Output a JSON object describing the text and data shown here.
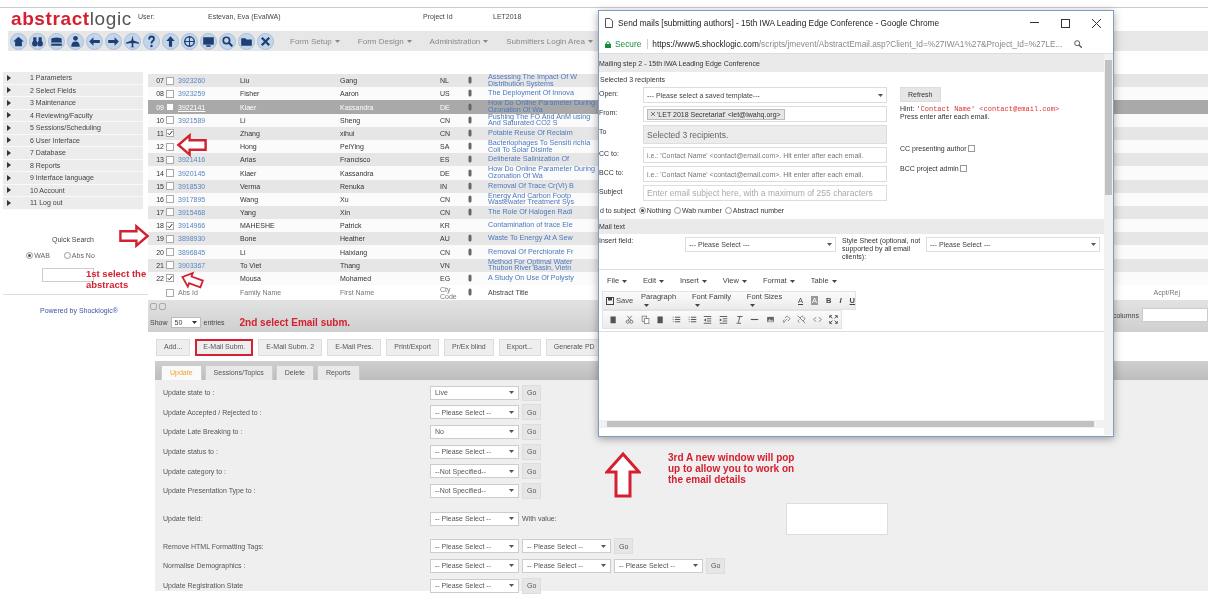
{
  "header": {
    "logo": {
      "part_1": "abstract",
      "part_2": "logic"
    },
    "user_label": "User:",
    "user_name": "Estevan, Eva (EvalWA)",
    "project_label": "Project Id",
    "project_id": "LET2018",
    "menus": [
      "Form Setup",
      "Form Design",
      "Administration",
      "Submitters Login Area"
    ]
  },
  "sidebar": {
    "items": [
      "1 Parameters",
      "2 Select Fields",
      "3 Maintenance",
      "4 Reviewing/Faculty",
      "5 Sessions/Scheduling",
      "6 User Interface",
      "7 Database",
      "8 Reports",
      "9 Interface language",
      "10 Account",
      "11 Log out"
    ],
    "quick_search": {
      "title": "Quick Search",
      "options": [
        {
          "label": "WAB",
          "selected": true
        },
        {
          "label": "Abs No",
          "selected": false
        }
      ]
    },
    "powered_by": "Powered by Shocklogic®"
  },
  "table": {
    "rows": [
      {
        "num": "07",
        "checked": false,
        "selected": false,
        "id": "3923260",
        "family": "Liu",
        "first": "Gang",
        "country": "NL",
        "attachment": true,
        "title": "Assessing The Impact Of W Distribution Systems"
      },
      {
        "num": "08",
        "checked": false,
        "selected": false,
        "id": "3923259",
        "family": "Fisher",
        "first": "Aaron",
        "country": "US",
        "attachment": true,
        "title": "The Deployment Of Innova"
      },
      {
        "num": "09",
        "checked": false,
        "selected": true,
        "id": "3922141",
        "family": "Klaer",
        "first": "Kassandra",
        "country": "DE",
        "attachment": true,
        "title": "How Do Online Parameter During Ozonation Of Wa"
      },
      {
        "num": "10",
        "checked": false,
        "selected": false,
        "id": "3921589",
        "family": "Li",
        "first": "Sheng",
        "country": "CN",
        "attachment": true,
        "title": "Pushing The FO And AnM using And Saturated CO2 S"
      },
      {
        "num": "11",
        "checked": true,
        "selected": false,
        "family": "Zhang",
        "first": "xihui",
        "country": "CN",
        "attachment": true,
        "title": "Potable Reuse Of Reclaim"
      },
      {
        "num": "12",
        "checked": false,
        "selected": false,
        "family": "Hong",
        "first": "PeiYing",
        "country": "SA",
        "attachment": true,
        "title": "Bacteriophages To Sensiti richia Coli To Solar Disinfe"
      },
      {
        "num": "13",
        "checked": false,
        "selected": false,
        "id": "3921416",
        "family": "Arias",
        "first": "Francisco",
        "country": "ES",
        "attachment": true,
        "title": "Deliberate Salinization Of"
      },
      {
        "num": "14",
        "checked": false,
        "selected": false,
        "id": "3920145",
        "family": "Klaer",
        "first": "Kassandra",
        "country": "DE",
        "attachment": true,
        "title": "How Do Online Parameter During Ozonation Of Wa"
      },
      {
        "num": "15",
        "checked": false,
        "selected": false,
        "id": "3918530",
        "family": "Verma",
        "first": "Renuka",
        "country": "IN",
        "attachment": true,
        "title": "Removal Of Trace Cr(VI) B"
      },
      {
        "num": "16",
        "checked": false,
        "selected": false,
        "id": "3917895",
        "family": "Wang",
        "first": "Xu",
        "country": "CN",
        "attachment": true,
        "title": "Energy And Carbon Footp Wastewater Treatment Sys"
      },
      {
        "num": "17",
        "checked": false,
        "selected": false,
        "id": "3915468",
        "family": "Yang",
        "first": "Xin",
        "country": "CN",
        "attachment": true,
        "title": "The Role Of Halogen Radi"
      },
      {
        "num": "18",
        "checked": true,
        "selected": false,
        "id": "3914966",
        "family": "MAHESHE",
        "first": "Patrick",
        "country": "KR",
        "attachment": false,
        "title": "Contamination of trace Ele"
      },
      {
        "num": "19",
        "checked": false,
        "selected": false,
        "id": "3898930",
        "family": "Bone",
        "first": "Heather",
        "country": "AU",
        "attachment": true,
        "title": "Waste To Energy At A Sew"
      },
      {
        "num": "20",
        "checked": false,
        "selected": false,
        "id": "3896845",
        "family": "Li",
        "first": "Haixiang",
        "country": "CN",
        "attachment": true,
        "title": "Removal Of Perchlorate Fr"
      },
      {
        "num": "21",
        "checked": false,
        "selected": false,
        "id": "3903367",
        "family": "To Viet",
        "first": "Thang",
        "country": "VN",
        "attachment": false,
        "title": "Method For Optimal Water Thubon River Basin, Vietn"
      },
      {
        "num": "22",
        "checked": true,
        "selected": false,
        "family": "Mousa",
        "first": "Mohamed",
        "country": "EG",
        "attachment": true,
        "title": "A Study On Use Of Polysty"
      }
    ],
    "footer": {
      "checked": false,
      "id": "Abs Id",
      "family": "Family Name",
      "first": "First Name",
      "country": "Cty Code",
      "title": "Abstract Title",
      "acpt": "Acpt/Rej"
    },
    "pager": {
      "show": "Show",
      "count": "50",
      "entries": "entries",
      "columns_label": "columns"
    }
  },
  "buttons": [
    {
      "label": "Add...",
      "outlined": false
    },
    {
      "label": "E-Mail Subm.",
      "outlined": true
    },
    {
      "label": "E-Mail Subm. 2",
      "outlined": false
    },
    {
      "label": "E-Mail Pres.",
      "outlined": false
    },
    {
      "label": "Print/Export",
      "outlined": false
    },
    {
      "label": "Pr/Ex blind",
      "outlined": false
    },
    {
      "label": "Export...",
      "outlined": false
    },
    {
      "label": "Generate PD",
      "outlined": false
    }
  ],
  "tabs": [
    {
      "label": "Update",
      "selected": true
    },
    {
      "label": "Sessions/Topics",
      "selected": false
    },
    {
      "label": "Delete",
      "selected": false
    },
    {
      "label": "Reports",
      "selected": false
    }
  ],
  "update_rows": [
    {
      "label": "Update state to :",
      "selects": [
        "Live"
      ],
      "go": "Go"
    },
    {
      "label": "Update Accepted / Rejected to :",
      "selects": [
        "-- Please Select --"
      ],
      "go": "Go"
    },
    {
      "label": "Update Late Breaking to :",
      "selects": [
        "No"
      ],
      "go": "Go"
    },
    {
      "label": "Update status to :",
      "selects": [
        "-- Please Select --"
      ],
      "go": "Go"
    },
    {
      "label": "Update category to :",
      "selects": [
        "--Not Specified--"
      ],
      "go": "Go"
    },
    {
      "label": "Update Presentation Type to :",
      "selects": [
        "--Not Specified--"
      ],
      "go": "Go"
    },
    {
      "label": "Update field:",
      "selects": [
        "-- Please Select --"
      ],
      "value_label": "With value:"
    },
    {
      "label": "Remove HTML Formatting Tags:",
      "selects": [
        "-- Please Select --",
        "-- Please Select --"
      ],
      "go": "Go"
    },
    {
      "label": "Normalise Demographics :",
      "selects": [
        "-- Please Select --",
        "-- Please Select --",
        "-- Please Select --"
      ],
      "go": "Go"
    },
    {
      "label": "Update Registration State",
      "selects": [
        "-- Please Select --"
      ],
      "go": "Go"
    }
  ],
  "popup": {
    "window_title": "Send mails [submitting authors] - 15th IWA Leading Edge Conference - Google Chrome",
    "secure": "Secure",
    "url_host": "https://www5.shocklogic.com",
    "url_path": "/scripts/jmevent/AbstractEmail.asp?Client_Id=%27IWA1%27&Project_Id=%27LE...",
    "step_title": "Mailing step 2 - 15th IWA Leading Edge Conference",
    "selected_note": "Selected 3 recipients",
    "fields": [
      {
        "label": "Open:",
        "kind": "select",
        "value": "--- Please select a saved template---"
      },
      {
        "label": "From:",
        "kind": "tags",
        "tags": [
          "'LET 2018 Secretariat' <let@iwahq.org>"
        ]
      },
      {
        "label": "To",
        "kind": "readonly",
        "value": "Selected 3 recipients."
      },
      {
        "label": "CC to:",
        "kind": "input",
        "placeholder": "i.e.: 'Contact Name' <contact@email.com>. Hit enter after each email."
      },
      {
        "label": "BCC to:",
        "kind": "input",
        "placeholder": "i.e.: 'Contact Name' <contact@email.com>. Hit enter after each email."
      },
      {
        "label": "Subject",
        "kind": "input",
        "placeholder": "Enter email subject here, with a maximum of 255 characters"
      }
    ],
    "refresh": "Refresh",
    "hint_label": "Hint:",
    "hint_code": "'Contact Name' <contact@email.com>",
    "hint_note": "Press enter after each email.",
    "options": [
      {
        "label": "CC presenting author",
        "checked": false
      },
      {
        "label": "BCC project admin",
        "checked": false
      }
    ],
    "add_to_subject": {
      "label": "d to subject",
      "options": [
        {
          "label": "Nothing",
          "selected": true
        },
        {
          "label": "Wab number",
          "selected": false
        },
        {
          "label": "Abstract number",
          "selected": false
        }
      ]
    },
    "mail_text": "Mail text",
    "insert_field": {
      "label": "Insert field:",
      "value": "--- Please Select ---"
    },
    "style_sheet": {
      "label": "Style Sheet (optional, not supported by all email clients):",
      "value": "--- Please Select ---"
    },
    "editor_menus": [
      "File",
      "Edit",
      "Insert",
      "View",
      "Format",
      "Table"
    ],
    "save": "Save",
    "dropdowns": [
      "Paragraph",
      "Font Family",
      "Font Sizes"
    ],
    "format_buttons": [
      {
        "label": "A",
        "kind": "text-color"
      },
      {
        "label": "A",
        "kind": "background-color"
      },
      {
        "label": "B",
        "kind": "bold"
      },
      {
        "label": "I",
        "kind": "italic"
      },
      {
        "label": "U",
        "kind": "underline"
      }
    ]
  },
  "annotations": {
    "step_1": "1st select the abstracts",
    "step_2": "2nd select Email subm.",
    "step_3": "3rd A new window will pop up to allow you to work on the email details"
  }
}
